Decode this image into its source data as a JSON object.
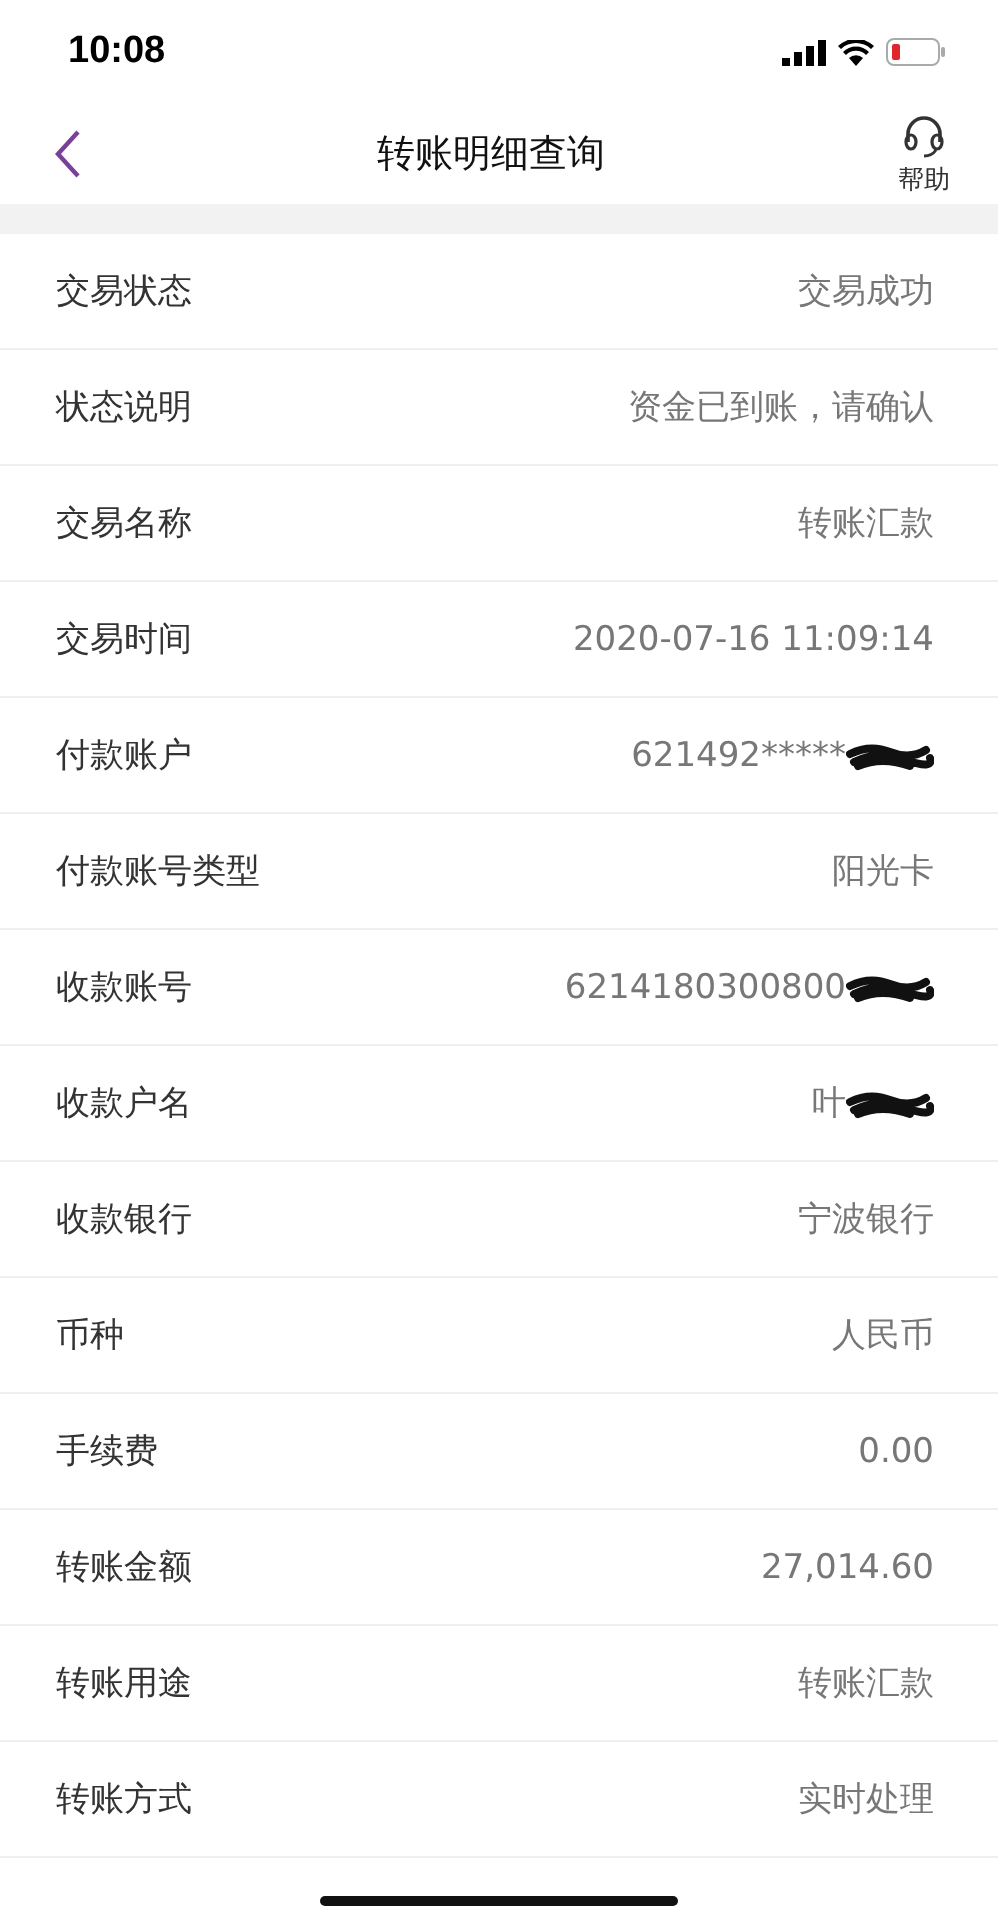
{
  "status_bar": {
    "time": "10:08"
  },
  "nav": {
    "title": "转账明细查询",
    "help_label": "帮助"
  },
  "rows": [
    {
      "label": "交易状态",
      "value": "交易成功",
      "redacted": false
    },
    {
      "label": "状态说明",
      "value": "资金已到账，请确认",
      "redacted": false
    },
    {
      "label": "交易名称",
      "value": "转账汇款",
      "redacted": false
    },
    {
      "label": "交易时间",
      "value": "2020-07-16 11:09:14",
      "redacted": false
    },
    {
      "label": "付款账户",
      "value": "621492*****",
      "redacted": true
    },
    {
      "label": "付款账号类型",
      "value": "阳光卡",
      "redacted": false
    },
    {
      "label": "收款账号",
      "value": "6214180300800",
      "redacted": true
    },
    {
      "label": "收款户名",
      "value": "叶",
      "redacted": true
    },
    {
      "label": "收款银行",
      "value": "宁波银行",
      "redacted": false
    },
    {
      "label": "币种",
      "value": "人民币",
      "redacted": false
    },
    {
      "label": "手续费",
      "value": "0.00",
      "redacted": false
    },
    {
      "label": "转账金额",
      "value": "27,014.60",
      "redacted": false
    },
    {
      "label": "转账用途",
      "value": "转账汇款",
      "redacted": false
    },
    {
      "label": "转账方式",
      "value": "实时处理",
      "redacted": false
    }
  ]
}
